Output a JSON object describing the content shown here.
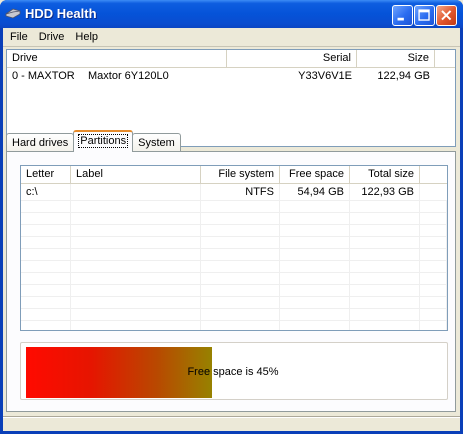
{
  "window": {
    "title": "HDD Health",
    "buttons": [
      "minimize",
      "maximize",
      "close"
    ]
  },
  "menu": [
    "File",
    "Drive",
    "Help"
  ],
  "drives": {
    "columns": [
      "Drive",
      "Serial",
      "Size"
    ],
    "rows": [
      {
        "id": "0 - MAXTOR",
        "model": "Maxtor 6Y120L0",
        "serial": "Y33V6V1E",
        "size": "122,94 GB"
      }
    ]
  },
  "tabs": [
    {
      "label": "Hard drives",
      "active": false
    },
    {
      "label": "Partitions",
      "active": true
    },
    {
      "label": "System",
      "active": false
    }
  ],
  "partitions": {
    "columns": [
      "Letter",
      "Label",
      "File system",
      "Free space",
      "Total size"
    ],
    "rows": [
      {
        "letter": "c:\\",
        "label": "",
        "filesystem": "NTFS",
        "free": "54,94 GB",
        "total": "122,93 GB"
      }
    ]
  },
  "free_space": {
    "text": "Free space is 45%",
    "percent": 45
  }
}
